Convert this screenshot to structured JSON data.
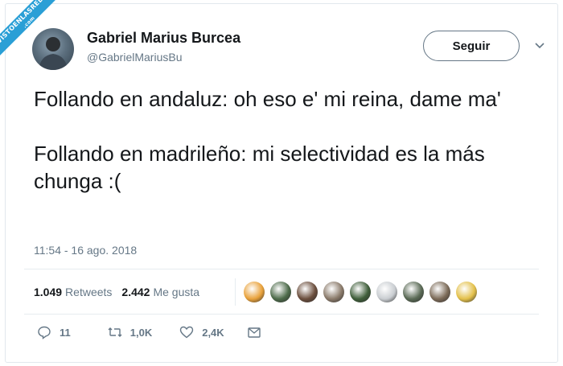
{
  "watermark": {
    "text": "VISTOENLASREDES",
    "sub": ".com"
  },
  "tweet": {
    "author_name": "Gabriel Marius Burcea",
    "author_handle": "@GabrielMariusBu",
    "follow_label": "Seguir",
    "text_1": "Follando en andaluz: oh eso e' mi reina, dame ma'",
    "text_2": "Follando en madrileño: mi selectividad es la más chunga :(",
    "timestamp": "11:54 - 16 ago. 2018"
  },
  "stats": {
    "retweets_count": "1.049",
    "retweets_label": "Retweets",
    "likes_count": "2.442",
    "likes_label": "Me gusta"
  },
  "likers": [
    {
      "icon": "avatar-1",
      "color": "#e9a23b"
    },
    {
      "icon": "avatar-2",
      "color": "#4d6b4a"
    },
    {
      "icon": "avatar-3",
      "color": "#6b4e3d"
    },
    {
      "icon": "avatar-4",
      "color": "#8a7a6a"
    },
    {
      "icon": "avatar-5",
      "color": "#3f5e3a"
    },
    {
      "icon": "avatar-6",
      "color": "#c9cdd1"
    },
    {
      "icon": "avatar-7",
      "color": "#5a6a55"
    },
    {
      "icon": "avatar-8",
      "color": "#7c6b58"
    },
    {
      "icon": "avatar-9",
      "color": "#e3c04a"
    }
  ],
  "actions": {
    "reply_count": "11",
    "retweet_count": "1,0K",
    "like_count": "2,4K"
  },
  "colors": {
    "text": "#14171a",
    "secondary": "#657786",
    "border": "#e1e8ed",
    "ribbon": "#2a9fd6"
  }
}
